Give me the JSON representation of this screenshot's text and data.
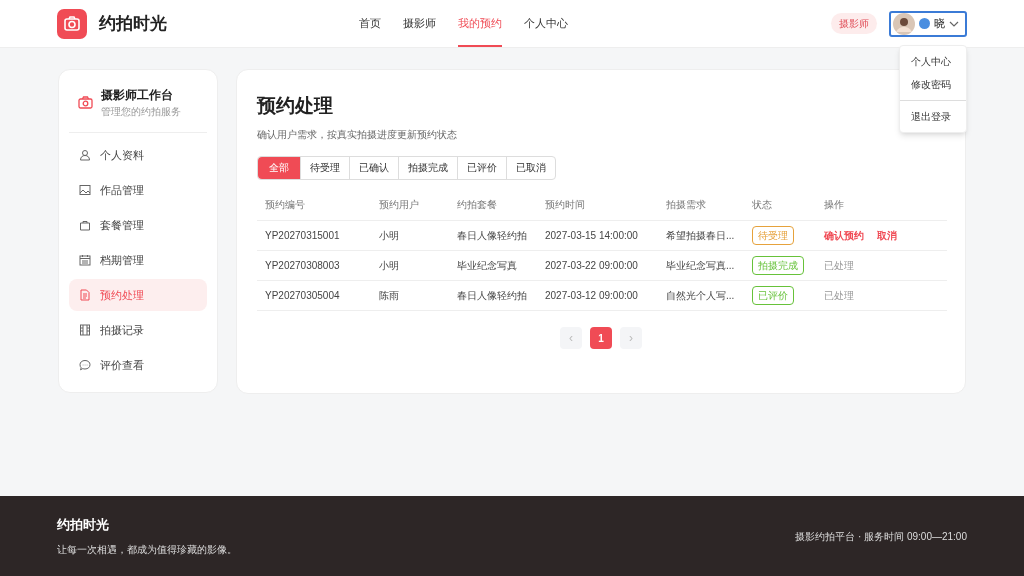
{
  "brand": "约拍时光",
  "nav": [
    {
      "label": "首页",
      "selected": false
    },
    {
      "label": "摄影师",
      "selected": false
    },
    {
      "label": "我的预约",
      "selected": true
    },
    {
      "label": "个人中心",
      "selected": false
    }
  ],
  "user": {
    "role": "摄影师",
    "name": "晓",
    "menu_expanded": true,
    "menu": [
      {
        "label": "个人中心"
      },
      {
        "label": "修改密码"
      },
      {
        "label": "退出登录",
        "divider_before": true
      }
    ]
  },
  "sidebar": {
    "title": "摄影师工作台",
    "subtitle": "管理您的约拍服务",
    "items": [
      {
        "label": "个人资料",
        "selected": false
      },
      {
        "label": "作品管理",
        "selected": false
      },
      {
        "label": "套餐管理",
        "selected": false
      },
      {
        "label": "档期管理",
        "selected": false
      },
      {
        "label": "预约处理",
        "selected": true
      },
      {
        "label": "拍摄记录",
        "selected": false
      },
      {
        "label": "评价查看",
        "selected": false
      }
    ]
  },
  "content": {
    "title": "预约处理",
    "subtitle": "确认用户需求，按真实拍摄进度更新预约状态",
    "filters": [
      {
        "label": "全部",
        "selected": true
      },
      {
        "label": "待受理",
        "selected": false
      },
      {
        "label": "已确认",
        "selected": false
      },
      {
        "label": "拍摄完成",
        "selected": false
      },
      {
        "label": "已评价",
        "selected": false
      },
      {
        "label": "已取消",
        "selected": false
      }
    ],
    "table": {
      "columns": [
        "预约编号",
        "预约用户",
        "约拍套餐",
        "预约时间",
        "拍摄需求",
        "状态",
        "操作"
      ],
      "rows": [
        {
          "id": "YP20270315001",
          "user": "小明",
          "package": "春日人像轻约拍",
          "time": "2027-03-15 14:00:00",
          "request": "希望拍摄春日...",
          "status": {
            "label": "待受理",
            "color": "#e6a23c"
          },
          "action": {
            "kind": "buttons",
            "primary": "确认预约",
            "secondary": "取消"
          }
        },
        {
          "id": "YP20270308003",
          "user": "小明",
          "package": "毕业纪念写真",
          "time": "2027-03-22 09:00:00",
          "request": "毕业纪念写真...",
          "status": {
            "label": "拍摄完成",
            "color": "#67c23a"
          },
          "action": {
            "kind": "done",
            "text": "已处理"
          }
        },
        {
          "id": "YP20270305004",
          "user": "陈雨",
          "package": "春日人像轻约拍",
          "time": "2027-03-12 09:00:00",
          "request": "自然光个人写...",
          "status": {
            "label": "已评价",
            "color": "#67c23a"
          },
          "action": {
            "kind": "done",
            "text": "已处理"
          }
        }
      ]
    },
    "pagination": {
      "prev": "‹",
      "next": "›",
      "pages": [
        {
          "label": "1",
          "selected": true
        }
      ]
    }
  },
  "footer": {
    "brand": "约拍时光",
    "tagline": "让每一次相遇，都成为值得珍藏的影像。",
    "info": "摄影约拍平台 · 服务时间 09:00—21:00"
  }
}
